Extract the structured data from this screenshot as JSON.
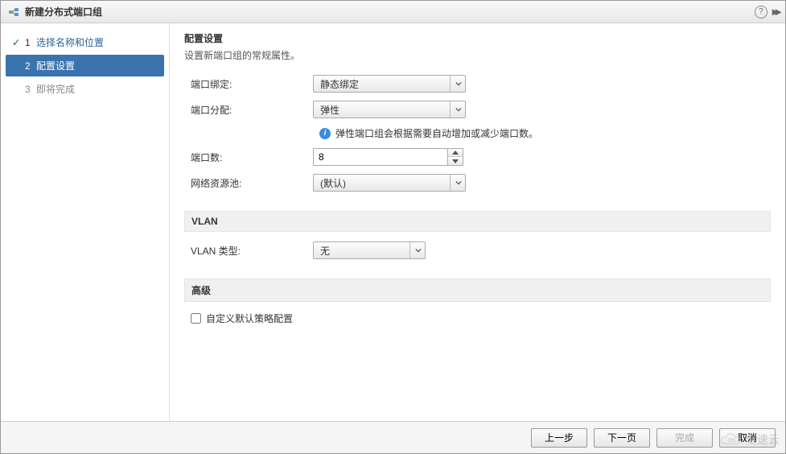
{
  "dialog": {
    "title": "新建分布式端口组"
  },
  "steps": {
    "s1": {
      "num": "1",
      "label": "选择名称和位置"
    },
    "s2": {
      "num": "2",
      "label": "配置设置"
    },
    "s3": {
      "num": "3",
      "label": "即将完成"
    }
  },
  "content": {
    "title": "配置设置",
    "desc": "设置新端口组的常规属性。",
    "port_binding_label": "端口绑定:",
    "port_binding_value": "静态绑定",
    "port_alloc_label": "端口分配:",
    "port_alloc_value": "弹性",
    "info_text": "弹性端口组会根据需要自动增加或减少端口数。",
    "port_count_label": "端口数:",
    "port_count_value": "8",
    "net_pool_label": "网络资源池:",
    "net_pool_value": "(默认)",
    "vlan_header": "VLAN",
    "vlan_type_label": "VLAN 类型:",
    "vlan_type_value": "无",
    "advanced_header": "高级",
    "custom_policy_label": "自定义默认策略配置"
  },
  "footer": {
    "back": "上一步",
    "next": "下一页",
    "finish": "完成",
    "cancel": "取消"
  },
  "watermark": "亿速云"
}
